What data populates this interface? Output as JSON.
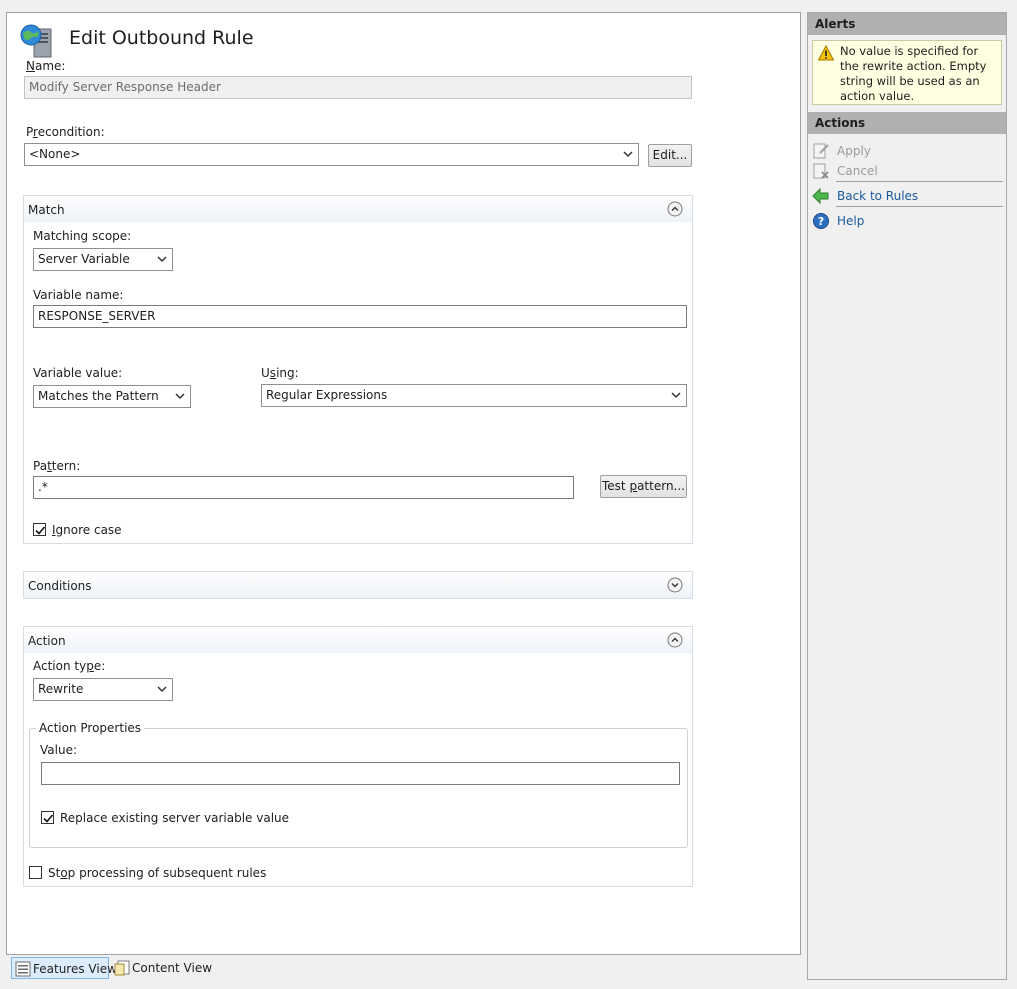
{
  "page": {
    "title": "Edit Outbound Rule"
  },
  "form": {
    "name_label_u": "N",
    "name_label_rest": "ame:",
    "name_value": "Modify Server Response Header",
    "precondition_label_p1": "P",
    "precondition_label_u": "r",
    "precondition_label_rest": "econdition:",
    "precondition_value": "<None>",
    "edit_button": "Edit..."
  },
  "match": {
    "title": "Match",
    "scope_label": "Matching scope:",
    "scope_value": "Server Variable",
    "variable_name_label": "Variable name:",
    "variable_name_value": "RESPONSE_SERVER",
    "variable_value_label": "Variable value:",
    "variable_value_value": "Matches the Pattern",
    "using_label_p1": "U",
    "using_label_u": "s",
    "using_label_rest": "ing:",
    "using_value": "Regular Expressions",
    "pattern_label_p1": "Pa",
    "pattern_label_u": "t",
    "pattern_label_rest": "tern:",
    "pattern_value": ".*",
    "test_button_p1": "Test ",
    "test_button_u": "p",
    "test_button_rest": "attern...",
    "ignore_case_u": "I",
    "ignore_case_rest": "gnore case",
    "ignore_case_checked": true
  },
  "conditions": {
    "title": "Conditions"
  },
  "action": {
    "title": "Action",
    "type_label_p1": "Action ty",
    "type_label_u": "p",
    "type_label_rest": "e:",
    "type_value": "Rewrite",
    "properties_legend": "Action Properties",
    "value_label": "Value:",
    "value_value": "",
    "replace_label": "Replace existing server variable value",
    "replace_checked": true,
    "stop_label_p1": "St",
    "stop_label_u": "o",
    "stop_label_rest": "p processing of subsequent rules",
    "stop_checked": false
  },
  "alerts": {
    "header": "Alerts",
    "message": "No value is specified for the rewrite action. Empty string will be used as an action value."
  },
  "actions": {
    "header": "Actions",
    "apply": "Apply",
    "cancel": "Cancel",
    "back": "Back to Rules",
    "help": "Help"
  },
  "tabs": {
    "features": "Features View",
    "content": "Content View"
  },
  "colors": {
    "link": "#1a5a9e",
    "alert_bg": "#ffffe1",
    "pane_header": "#b0b0b0"
  },
  "icons": [
    "web-server-globe-icon",
    "chevron-down-icon",
    "collapse-up-icon",
    "expand-down-icon",
    "warning-icon",
    "apply-icon",
    "cancel-icon",
    "back-arrow-icon",
    "help-icon",
    "features-view-icon",
    "content-view-icon"
  ]
}
